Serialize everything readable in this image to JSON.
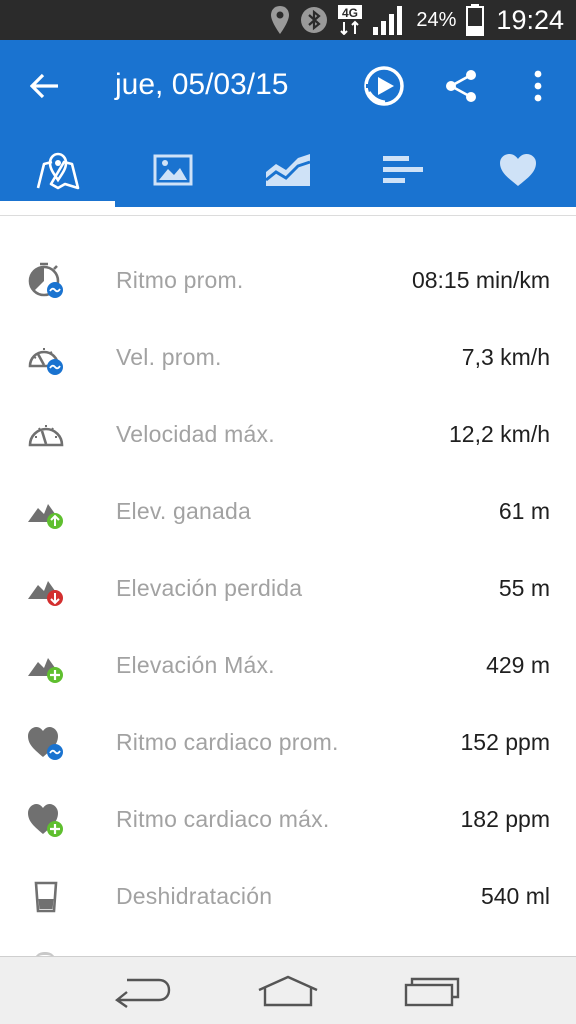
{
  "status_bar": {
    "network": "4G",
    "battery": "24%",
    "time": "19:24",
    "icons": [
      "location-icon",
      "bluetooth-icon",
      "network-4g-icon",
      "signal-icon",
      "battery-icon"
    ]
  },
  "toolbar": {
    "title": "jue, 05/03/15",
    "back_icon": "arrow-back-icon",
    "actions": [
      "replay-icon",
      "share-icon",
      "more-vert-icon"
    ]
  },
  "tabs": [
    {
      "icon": "map-icon",
      "active": true
    },
    {
      "icon": "photo-icon",
      "active": false
    },
    {
      "icon": "chart-icon",
      "active": false
    },
    {
      "icon": "bars-icon",
      "active": false
    },
    {
      "icon": "heart-icon",
      "active": false
    }
  ],
  "stats": [
    {
      "label": "Ritmo prom.",
      "value": "08:15 min/km",
      "icon": "pace-avg-icon"
    },
    {
      "label": "Vel. prom.",
      "value": "7,3 km/h",
      "icon": "speed-avg-icon"
    },
    {
      "label": "Velocidad máx.",
      "value": "12,2 km/h",
      "icon": "speedometer-icon"
    },
    {
      "label": "Elev. ganada",
      "value": "61 m",
      "icon": "elevation-gain-icon"
    },
    {
      "label": "Elevación perdida",
      "value": "55 m",
      "icon": "elevation-loss-icon"
    },
    {
      "label": "Elevación Máx.",
      "value": "429 m",
      "icon": "elevation-max-icon"
    },
    {
      "label": "Ritmo cardiaco prom.",
      "value": "152 ppm",
      "icon": "heart-rate-avg-icon"
    },
    {
      "label": "Ritmo cardiaco máx.",
      "value": "182 ppm",
      "icon": "heart-rate-max-icon"
    },
    {
      "label": "Deshidratación",
      "value": "540 ml",
      "icon": "water-glass-icon"
    }
  ],
  "nav_bar": [
    "back-nav-icon",
    "home-nav-icon",
    "recents-nav-icon"
  ],
  "colors": {
    "app_bar": "#1a73d0",
    "status_bar": "#2b2b2b",
    "label_gray": "#a2a2a2",
    "value_text": "#1f1f1f",
    "badge_blue": "#1a73d0",
    "badge_green": "#5fbf2f",
    "badge_red": "#d32f2f"
  }
}
